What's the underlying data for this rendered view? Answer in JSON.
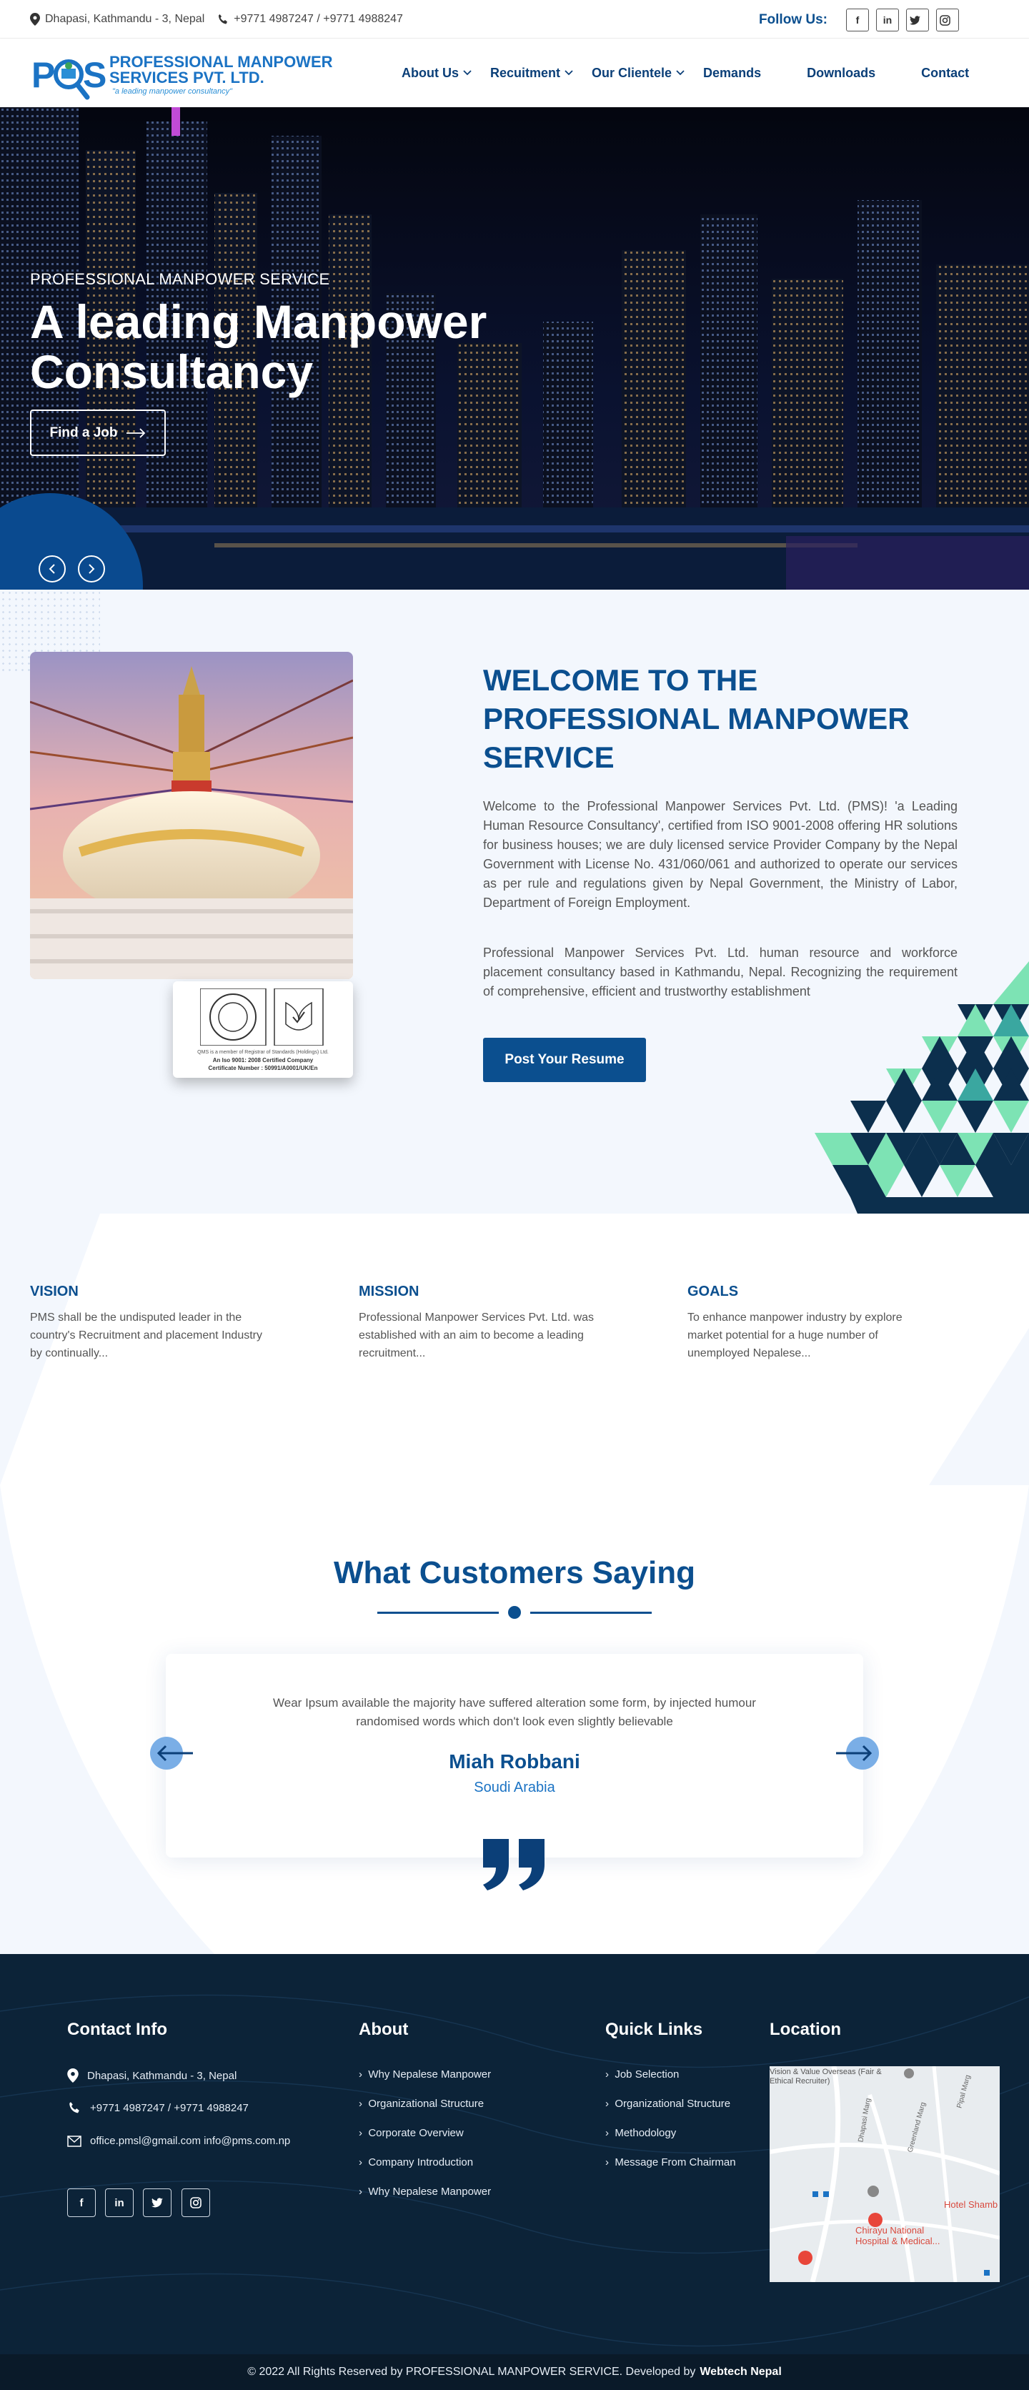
{
  "topbar": {
    "address": "Dhapasi, Kathmandu - 3, Nepal",
    "phone": "+9771 4987247 / +9771 4988247",
    "follow_label": "Follow Us:",
    "social": [
      {
        "icon": "facebook-icon",
        "glyph": "f"
      },
      {
        "icon": "linkedin-icon",
        "glyph": "in"
      },
      {
        "icon": "twitter-icon",
        "glyph": "t"
      },
      {
        "icon": "instagram-icon",
        "glyph": "◎"
      }
    ]
  },
  "header": {
    "logo_line1": "PROFESSIONAL MANPOWER",
    "logo_line2": "SERVICES PVT. LTD.",
    "logo_tagline": "\"a leading manpower consultancy\"",
    "nav": [
      {
        "label": "About Us",
        "dropdown": true
      },
      {
        "label": "Recuitment",
        "dropdown": true
      },
      {
        "label": "Our Clientele",
        "dropdown": true
      },
      {
        "label": "Demands",
        "dropdown": false
      },
      {
        "label": "Downloads",
        "dropdown": false
      },
      {
        "label": "Contact",
        "dropdown": false
      }
    ]
  },
  "hero": {
    "subtitle": "PROFESSIONAL MANPOWER SERVICE",
    "title": "A leading Manpower Consultancy",
    "cta": "Find a Job"
  },
  "welcome": {
    "title": "WELCOME TO THE PROFESSIONAL MANPOWER SERVICE",
    "para1": "Welcome to the Professional Manpower Services Pvt. Ltd. (PMS)! 'a Leading Human Resource Consultancy', certified from ISO 9001-2008 offering HR solutions for business houses; we are duly licensed service Provider Company by the Nepal Government with License No. 431/060/061 and authorized to operate our services as per rule and regulations given by Nepal Government, the Ministry of Labor, Department of Foreign Employment.",
    "para2": "Professional Manpower Services Pvt. Ltd. human resource and workforce placement consultancy based in Kathmandu, Nepal. Recognizing the requirement of comprehensive, efficient and trustworthy establishment",
    "cta": "Post Your Resume",
    "cert_line1": "QMS is a member of Registrar of Standards (Holdings) Ltd.",
    "cert_line2": "An Iso 9001: 2008 Certified Company",
    "cert_line3": "Certificate Number : 50991/A0001/UK/En"
  },
  "values": [
    {
      "title": "VISION",
      "text": "PMS shall be the undisputed leader in the country's Recruitment and placement Industry by continually..."
    },
    {
      "title": "MISSION",
      "text": "Professional Manpower Services Pvt. Ltd. was established with an aim to become a leading recruitment..."
    },
    {
      "title": "GOALS",
      "text": "To enhance manpower industry by explore market potential for a huge number of unemployed Nepalese..."
    }
  ],
  "testimonials": {
    "title": "What Customers Saying",
    "quote": "Wear Ipsum available the majority have suffered alteration some form, by injected humour randomised words which don't look even slightly believable",
    "name": "Miah Robbani",
    "country": "Soudi Arabia"
  },
  "footer": {
    "contact_title": "Contact Info",
    "address": "Dhapasi, Kathmandu - 3, Nepal",
    "phone": "+9771 4987247 / +9771 4988247",
    "email": "office.pmsl@gmail.com info@pms.com.np",
    "about_title": "About",
    "about_links": [
      "Why Nepalese Manpower",
      "Organizational Structure",
      "Corporate Overview",
      "Company Introduction",
      "Why Nepalese Manpower"
    ],
    "quick_title": "Quick Links",
    "quick_links": [
      "Job Selection",
      "Organizational Structure",
      "Methodology",
      "Message From Chairman"
    ],
    "location_title": "Location",
    "map_labels": {
      "place1": "Vision & Value Overseas (Fair & Ethical Recruiter)",
      "place2": "Hotel Shamb",
      "place3": "Chirayu National Hospital & Medical...",
      "road1": "Dhapasi Marg",
      "road2": "Greenland Marg",
      "road3": "Pipal Marg"
    },
    "copyright": "© 2022 All Rights Reserved by PROFESSIONAL MANPOWER SERVICE. Developed by",
    "developer": "Webtech Nepal"
  },
  "colors": {
    "primary": "#0b4f8f",
    "footer": "#0c2338",
    "accent_green": "#7de3b4"
  }
}
